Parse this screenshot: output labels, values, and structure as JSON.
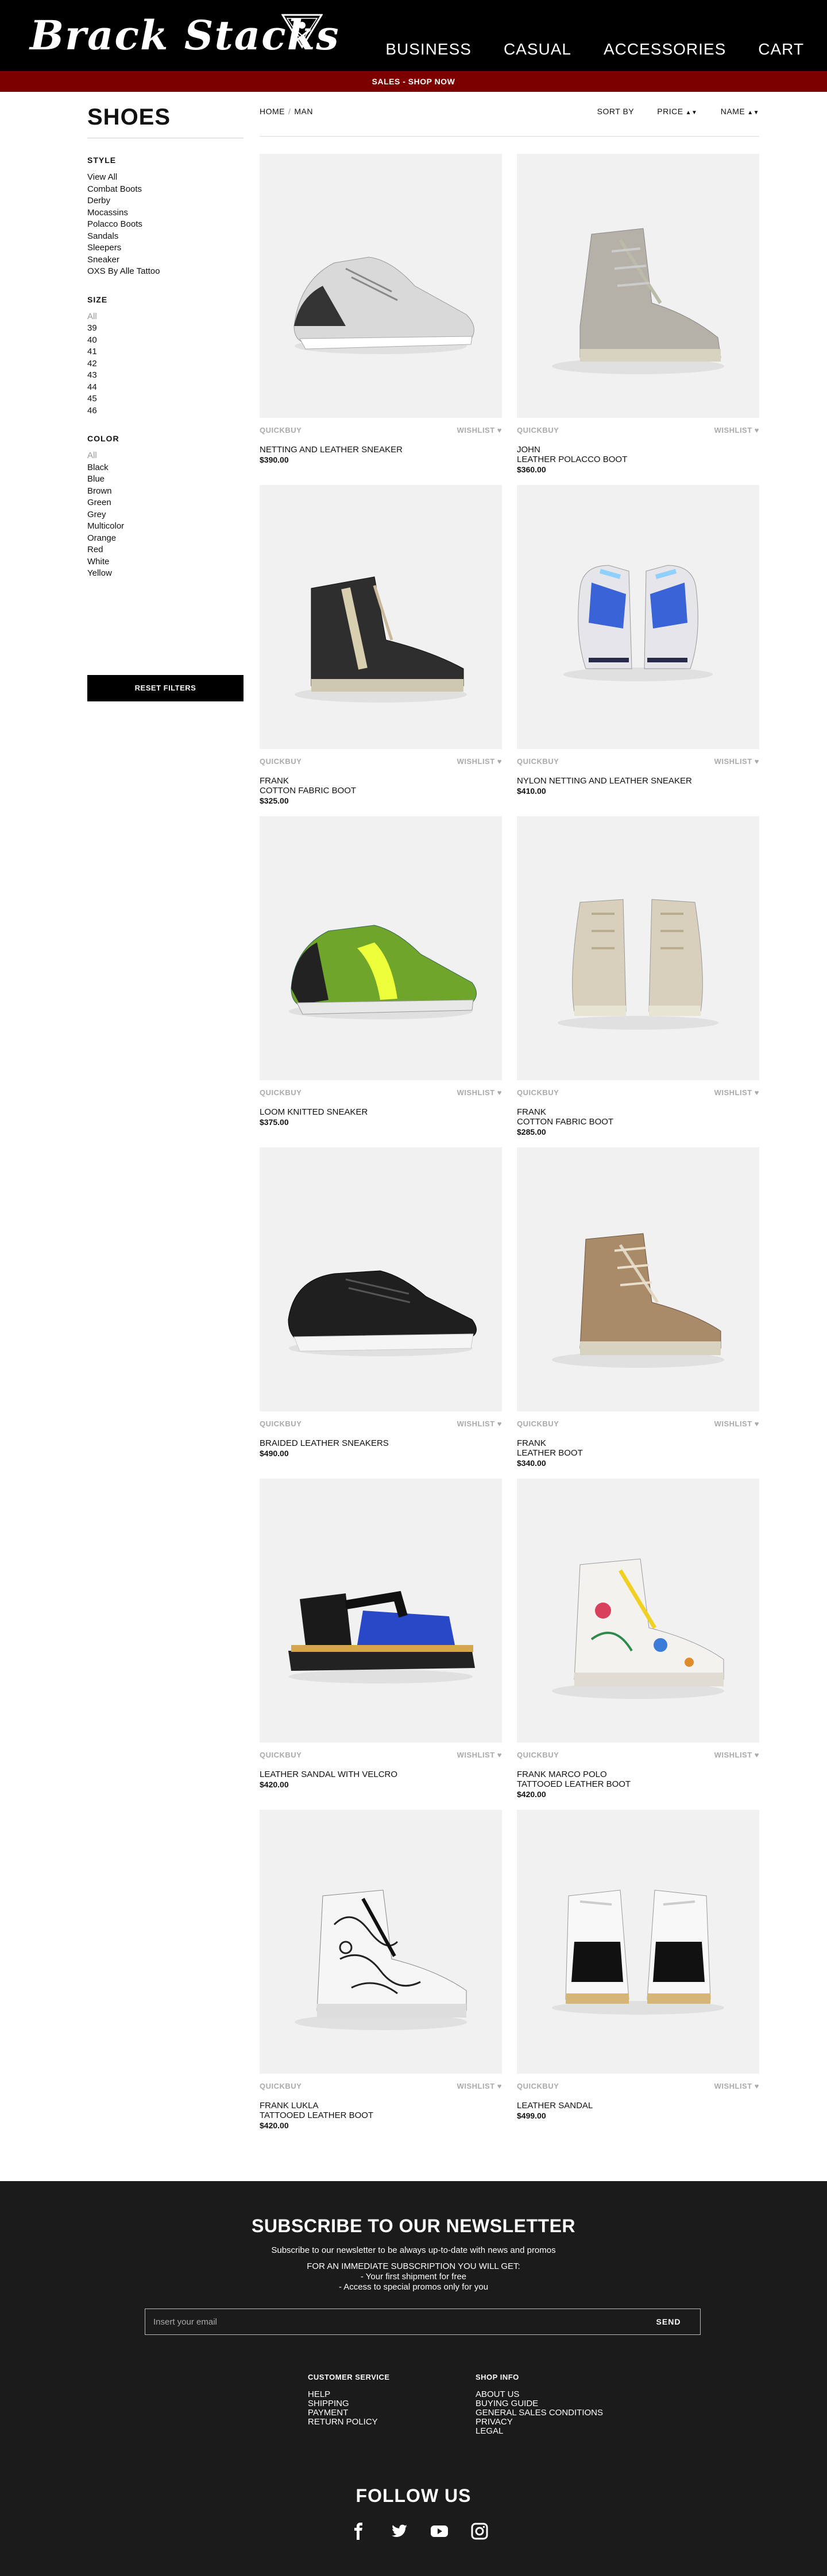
{
  "header": {
    "logo": "Brack Stacks",
    "nav": [
      "BUSINESS",
      "CASUAL",
      "ACCESSORIES",
      "CART"
    ]
  },
  "promo": "SALES - SHOP NOW",
  "sidebar": {
    "title": "SHOES",
    "style": {
      "title": "STYLE",
      "items": [
        "View All",
        "Combat Boots",
        "Derby",
        "Mocassins",
        "Polacco Boots",
        "Sandals",
        "Sleepers",
        "Sneaker",
        "OXS By Alle Tattoo"
      ]
    },
    "size": {
      "title": "SIZE",
      "items": [
        "All",
        "39",
        "40",
        "41",
        "42",
        "43",
        "44",
        "45",
        "46"
      ]
    },
    "color": {
      "title": "COLOR",
      "items": [
        "All",
        "Black",
        "Blue",
        "Brown",
        "Green",
        "Grey",
        "Multicolor",
        "Orange",
        "Red",
        "White",
        "Yellow"
      ]
    },
    "reset_label": "RESET FILTERS"
  },
  "breadcrumb": {
    "home": "HOME",
    "sep": "/",
    "current": "MAN"
  },
  "sort": {
    "label": "SORT BY",
    "price": "PRICE",
    "name": "NAME",
    "arrows": "▲▼"
  },
  "product_actions": {
    "quickbuy": "QUICKBUY",
    "wishlist": "WISHLIST ♥"
  },
  "products": [
    {
      "name": "NETTING AND LEATHER SNEAKER",
      "price": "$390.00",
      "icon": "grey-sneaker"
    },
    {
      "name": "JOHN\nLEATHER POLACCO BOOT",
      "price": "$360.00",
      "icon": "grey-boot"
    },
    {
      "name": "FRANK\nCOTTON FABRIC BOOT",
      "price": "$325.00",
      "icon": "black-boot"
    },
    {
      "name": "NYLON NETTING AND LEATHER SNEAKER",
      "price": "$410.00",
      "icon": "blue-sneakers-pair"
    },
    {
      "name": "LOOM KNITTED SNEAKER",
      "price": "$375.00",
      "icon": "green-sneaker"
    },
    {
      "name": "FRANK\nCOTTON FABRIC BOOT",
      "price": "$285.00",
      "icon": "beige-boots-pair"
    },
    {
      "name": "BRAIDED LEATHER SNEAKERS",
      "price": "$490.00",
      "icon": "black-sneaker"
    },
    {
      "name": "FRANK\nLEATHER BOOT",
      "price": "$340.00",
      "icon": "brown-boot"
    },
    {
      "name": "LEATHER SANDAL WITH VELCRO",
      "price": "$420.00",
      "icon": "blue-sandal"
    },
    {
      "name": "FRANK MARCO POLO\nTATTOOED LEATHER BOOT",
      "price": "$420.00",
      "icon": "tattooed-boot"
    },
    {
      "name": "FRANK LUKLA\nTATTOOED LEATHER BOOT",
      "price": "$420.00",
      "icon": "tattooed-boot-bw"
    },
    {
      "name": "LEATHER SANDAL",
      "price": "$499.00",
      "icon": "white-sandals-pair"
    }
  ],
  "newsletter": {
    "title": "SUBSCRIBE TO OUR NEWSLETTER",
    "subtitle": "Subscribe to our newsletter to be always up-to-date with news and promos",
    "benefits_title": "FOR AN IMMEDIATE SUBSCRIPTION YOU WILL GET:",
    "benefit_1": "- Your first shipment for free",
    "benefit_2": "- Access to special promos only for you",
    "placeholder": "Insert your email",
    "send": "SEND"
  },
  "footer": {
    "customer_service": {
      "title": "CUSTOMER SERVICE",
      "links": [
        "HELP",
        "SHIPPING",
        "PAYMENT",
        "RETURN POLICY"
      ]
    },
    "shop_info": {
      "title": "SHOP INFO",
      "links": [
        "ABOUT US",
        "BUYING GUIDE",
        "GENERAL SALES CONDITIONS",
        "PRIVACY",
        "LEGAL"
      ]
    },
    "follow_title": "FOLLOW US",
    "social": [
      "facebook-icon",
      "twitter-icon",
      "youtube-icon",
      "instagram-icon"
    ]
  },
  "colors": {
    "promo_bg": "#7d0000",
    "header_bg": "#000000",
    "footer_bg": "#1b1b1b",
    "card_bg": "#f1f1f1"
  }
}
